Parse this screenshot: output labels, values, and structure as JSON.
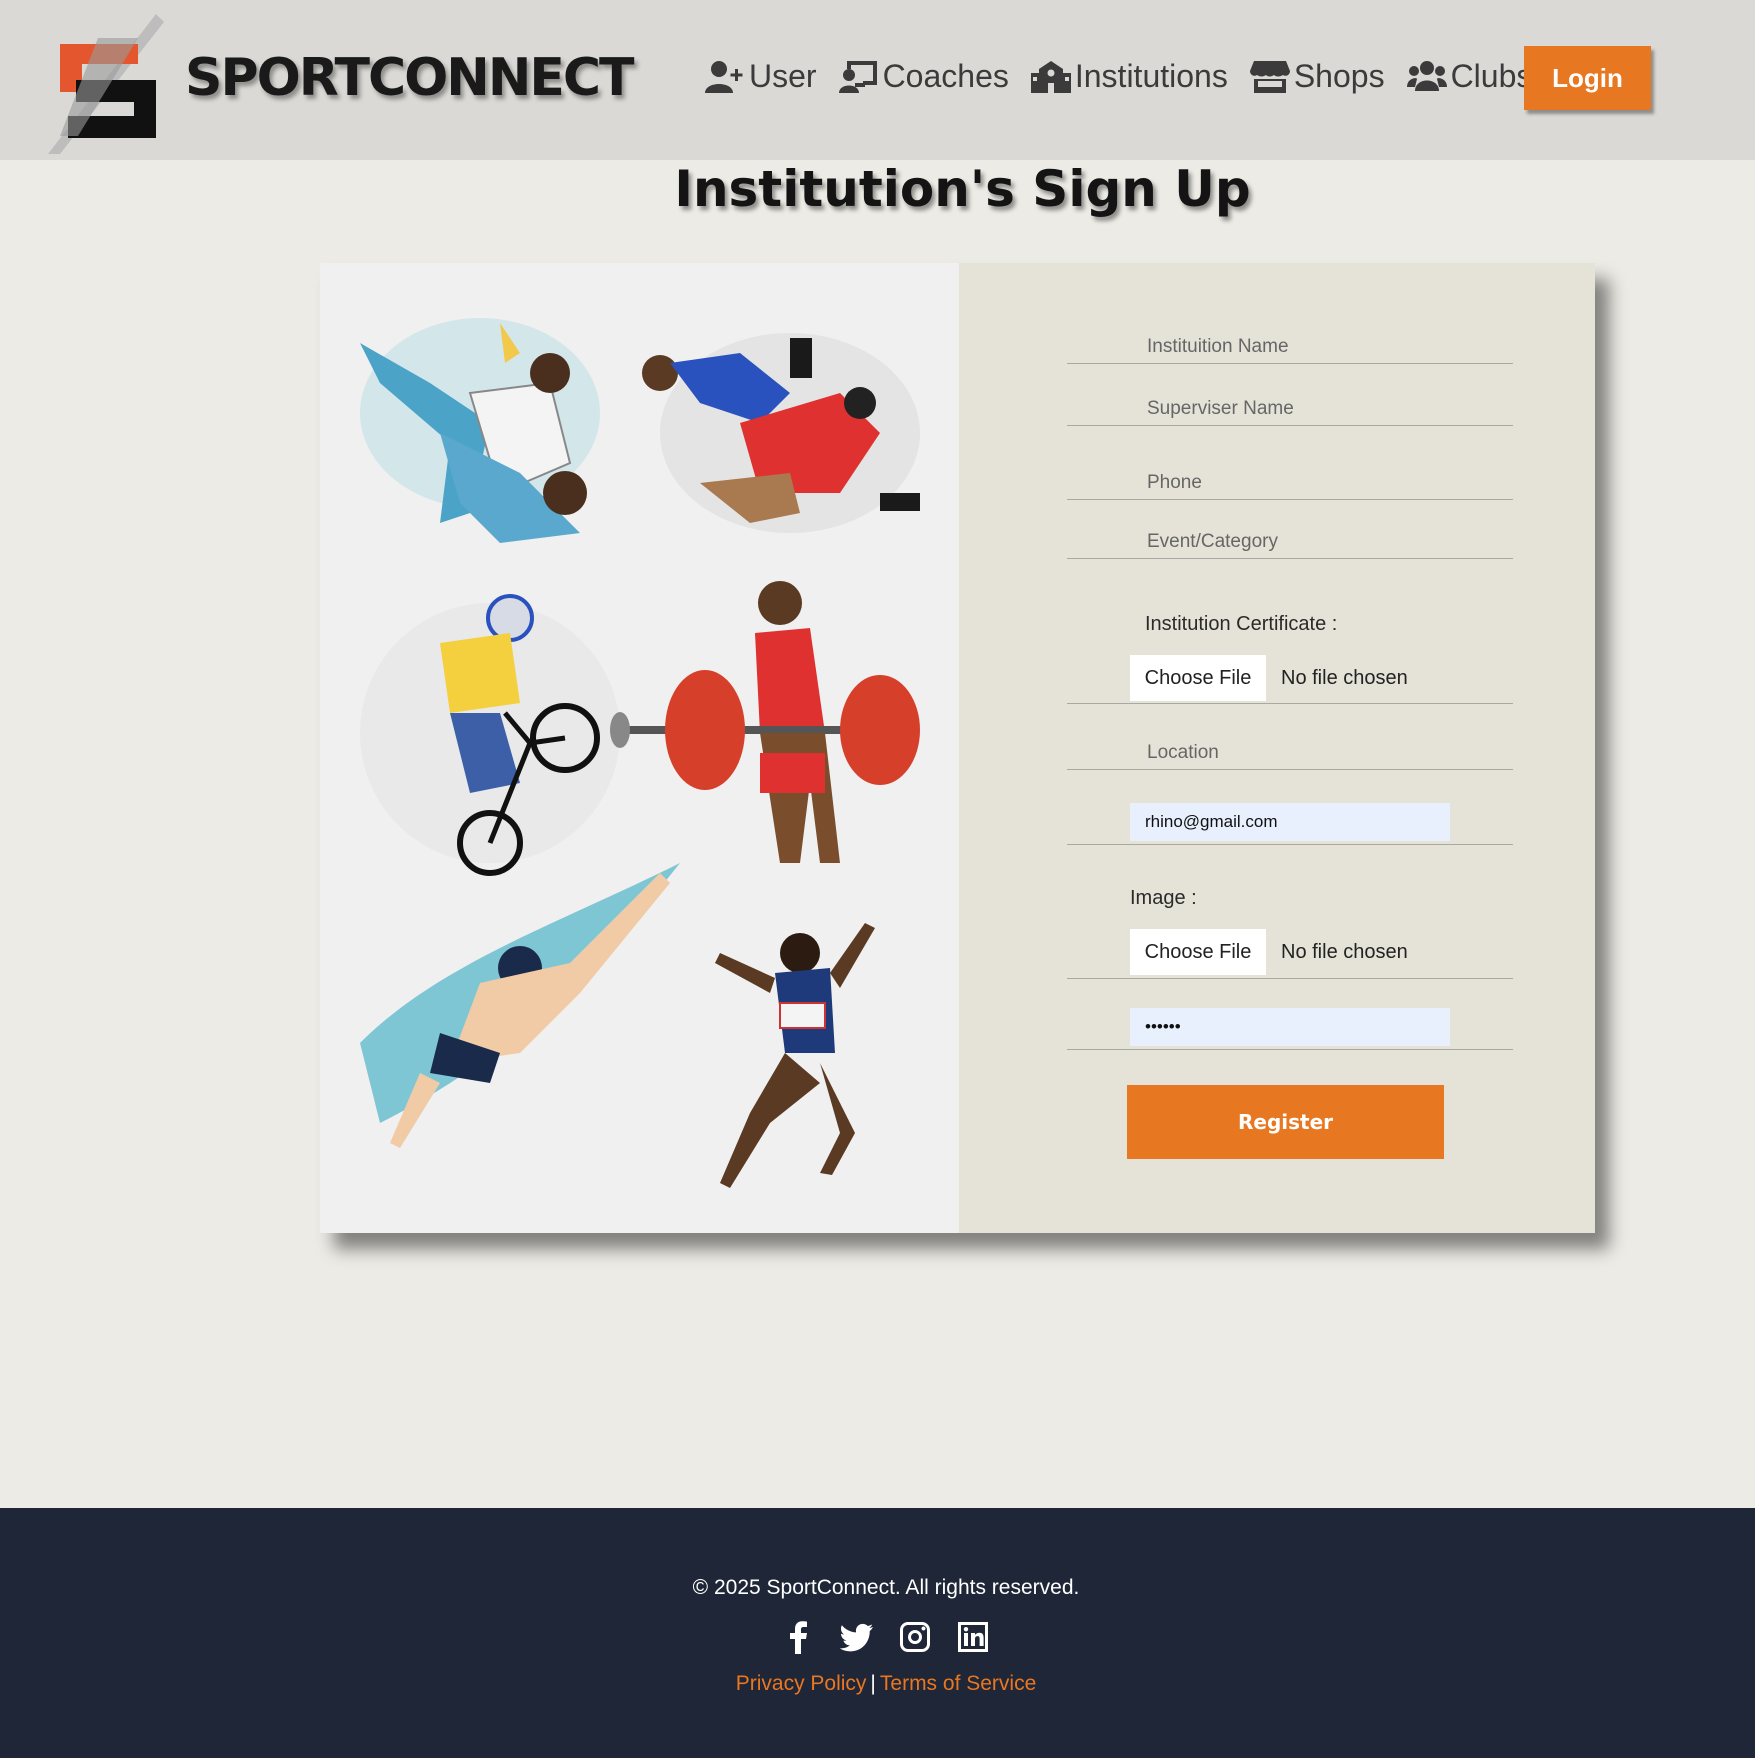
{
  "header": {
    "brand": "SPORTCONNECT",
    "logo_letter": "S",
    "nav": [
      {
        "label": " User",
        "icon": "user-plus-icon"
      },
      {
        "label": "Coaches",
        "icon": "chalkboard-teacher-icon"
      },
      {
        "label": "Institutions",
        "icon": "school-icon"
      },
      {
        "label": "Shops",
        "icon": "store-icon"
      },
      {
        "label": "Clubs",
        "icon": "users-icon"
      }
    ],
    "login_label": "Login"
  },
  "page_title": "Institution's Sign Up",
  "form": {
    "institution_name_placeholder": "Instituition Name",
    "supervisor_name_placeholder": "Superviser Name",
    "phone_placeholder": "Phone",
    "event_category_placeholder": "Event/Category",
    "certificate_label": "Institution Certificate :",
    "choose_file_label": "Choose File",
    "no_file_text": "No file chosen",
    "location_placeholder": "Location",
    "email_value": "rhino@gmail.com",
    "image_label": "Image :",
    "password_value": "••••••",
    "register_label": "Register"
  },
  "footer": {
    "copyright": "© 2025 SportConnect. All rights reserved.",
    "social_icons": [
      "facebook-icon",
      "twitter-icon",
      "instagram-icon",
      "linkedin-icon"
    ],
    "privacy_label": "Privacy Policy",
    "separator": "|",
    "terms_label": "Terms of Service"
  },
  "colors": {
    "accent": "#e87722",
    "header_bg": "#dad9d5",
    "page_bg": "#ecebe5",
    "form_bg": "#e5e3d8",
    "footer_bg": "#1e2638",
    "autofill_bg": "#e8f0fe"
  }
}
